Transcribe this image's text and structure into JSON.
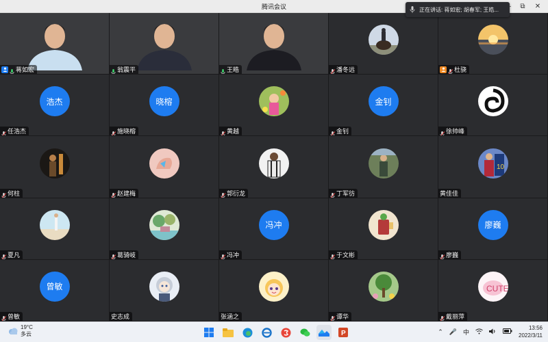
{
  "window": {
    "title": "腾讯会议"
  },
  "speaking": {
    "text": "正在讲话: 蒋如宏; 胡春军; 王皓..."
  },
  "participants": [
    {
      "name": "蒋如宏",
      "kind": "video",
      "scene": "bookshelf",
      "host": true,
      "host_color": "#1e7cf0",
      "mic": "on"
    },
    {
      "name": "翁震平",
      "kind": "video",
      "scene": "office",
      "mic": "on"
    },
    {
      "name": "王皓",
      "kind": "video",
      "scene": "room",
      "mic": "on"
    },
    {
      "name": "潘冬远",
      "kind": "image",
      "icon": "horse-rider-avatar",
      "mic": "off"
    },
    {
      "name": "杜骁",
      "kind": "image",
      "icon": "sunset-avatar",
      "host": true,
      "host_color": "#f08a24",
      "mic": "off"
    },
    {
      "name": "任浩杰",
      "kind": "text",
      "avatar_text": "浩杰",
      "mic": "off"
    },
    {
      "name": "施晓榕",
      "kind": "text",
      "avatar_text": "晓榕",
      "mic": "off"
    },
    {
      "name": "黄越",
      "kind": "image",
      "icon": "child-flowers-avatar",
      "mic": "off"
    },
    {
      "name": "金钊",
      "kind": "text",
      "avatar_text": "金钊",
      "mic": "off"
    },
    {
      "name": "徐帅峰",
      "kind": "image",
      "icon": "swirl-logo-avatar",
      "mic": "off"
    },
    {
      "name": "何柱",
      "kind": "image",
      "icon": "dark-figure-avatar",
      "mic": "off"
    },
    {
      "name": "赵建梅",
      "kind": "image",
      "icon": "hand-heart-avatar",
      "mic": "off"
    },
    {
      "name": "郭衍龙",
      "kind": "image",
      "icon": "jersey-player-avatar",
      "mic": "off"
    },
    {
      "name": "丁军彷",
      "kind": "image",
      "icon": "outdoor-person-avatar",
      "mic": "off"
    },
    {
      "name": "黄佳佳",
      "kind": "image",
      "icon": "soccer-player-avatar",
      "mic": "none"
    },
    {
      "name": "夏凡",
      "kind": "image",
      "icon": "beach-avatar",
      "mic": "off"
    },
    {
      "name": "葛骑岐",
      "kind": "image",
      "icon": "painted-landscape-avatar",
      "mic": "off"
    },
    {
      "name": "冯冲",
      "kind": "text",
      "avatar_text": "冯冲",
      "mic": "off"
    },
    {
      "name": "于文彬",
      "kind": "image",
      "icon": "drink-cup-avatar",
      "mic": "off"
    },
    {
      "name": "廖巍",
      "kind": "text",
      "avatar_text": "廖巍",
      "mic": "off"
    },
    {
      "name": "曾敏",
      "kind": "text",
      "avatar_text": "曾敏",
      "mic": "off"
    },
    {
      "name": "史志成",
      "kind": "image",
      "icon": "anime-character-avatar",
      "mic": "none"
    },
    {
      "name": "张涵之",
      "kind": "image",
      "icon": "cartoon-girl-avatar",
      "mic": "none"
    },
    {
      "name": "谭华",
      "kind": "image",
      "icon": "tree-garden-avatar",
      "mic": "off"
    },
    {
      "name": "戴丽萍",
      "kind": "image",
      "icon": "pink-cartoon-avatar",
      "mic": "off"
    }
  ],
  "taskbar": {
    "weather": {
      "temp": "19°C",
      "desc": "多云"
    },
    "apps": [
      "windows-start-icon",
      "file-explorer-icon",
      "edge-browser-icon",
      "ie-browser-icon",
      "sogou-icon",
      "wechat-icon",
      "tencent-meeting-icon",
      "powerpoint-icon"
    ],
    "tray": {
      "ime": "中",
      "time": "13:56",
      "date": "2022/3/11"
    }
  },
  "colors": {
    "accent": "#1e7cf0",
    "tile_bg": "#2b2c2f"
  }
}
